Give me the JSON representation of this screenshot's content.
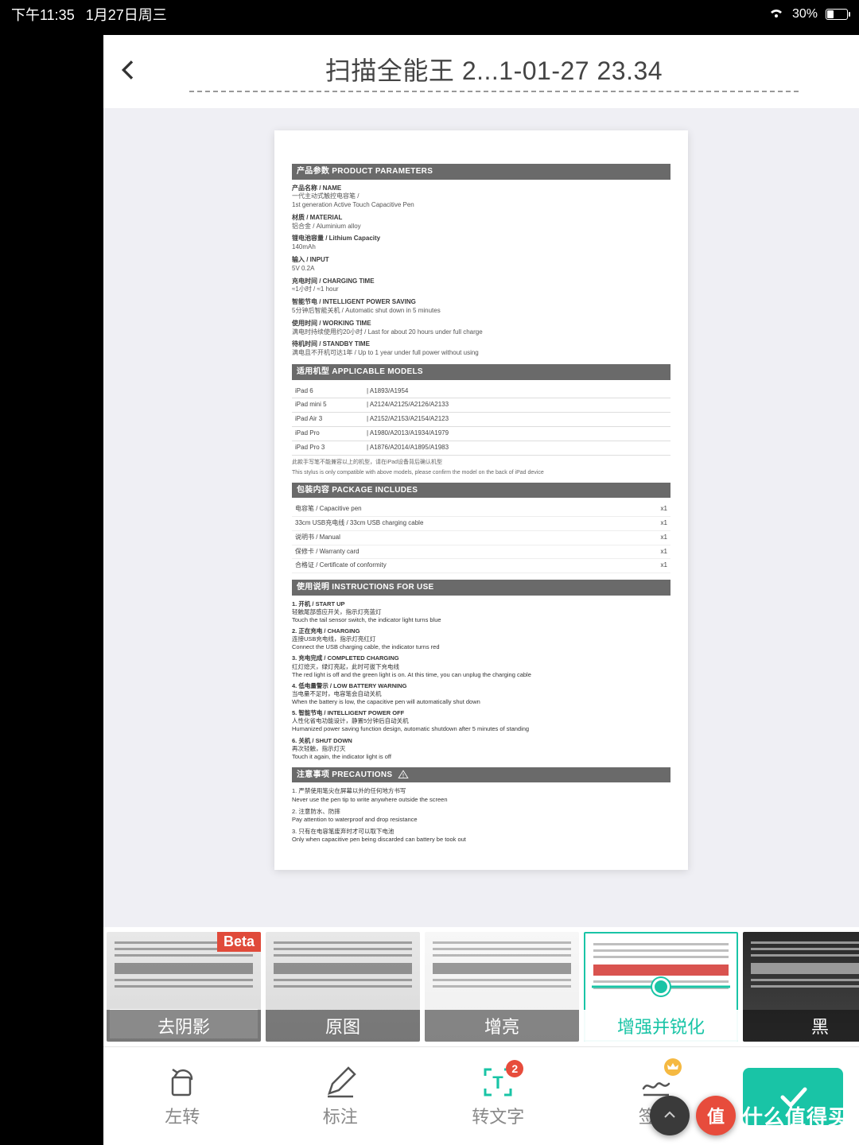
{
  "status": {
    "time": "下午11:35",
    "date": "1月27日周三",
    "battery": "30%"
  },
  "header": {
    "title": "扫描全能王 2...1-01-27 23.34"
  },
  "doc": {
    "sections": {
      "params": {
        "title": "产品参数 PRODUCT PARAMETERS",
        "items": [
          {
            "lbl": "产品名称 / NAME",
            "sub": "一代主动式触控电容笔 /",
            "sub2": "1st generation Active Touch Capacitive Pen"
          },
          {
            "lbl": "材质 / MATERIAL",
            "sub": "铝合金 / Aluminium alloy"
          },
          {
            "lbl": "锂电池容量 / Lithium Capacity",
            "sub": "140mAh"
          },
          {
            "lbl": "输入 / INPUT",
            "sub": "5V 0.2A"
          },
          {
            "lbl": "充电时间 / CHARGING TIME",
            "sub": "≈1小时 / ≈1 hour"
          },
          {
            "lbl": "智能节电 / INTELLIGENT POWER SAVING",
            "sub": "5分钟后智能关机 / Automatic shut down in 5 minutes"
          },
          {
            "lbl": "使用时间 / WORKING TIME",
            "sub": "满电时持续使用约20小时 / Last for about 20 hours under full charge"
          },
          {
            "lbl": "待机时间 / STANDBY TIME",
            "sub": "满电且不开机可达1年 / Up to 1 year under full power without using"
          }
        ]
      },
      "models": {
        "title": "适用机型 APPLICABLE MODELS",
        "rows": [
          {
            "k": "iPad 6",
            "v": "| A1893/A1954"
          },
          {
            "k": "iPad mini 5",
            "v": "| A2124/A2125/A2126/A2133"
          },
          {
            "k": "iPad Air 3",
            "v": "| A2152/A2153/A2154/A2123"
          },
          {
            "k": "iPad Pro",
            "v": "| A1980/A2013/A1934/A1979"
          },
          {
            "k": "iPad Pro 3",
            "v": "| A1876/A2014/A1895/A1983"
          }
        ],
        "note_cn": "此款手写笔不能兼容以上的机型，请在iPad设备背后确认机型",
        "note_en": "This stylus is only compatible with above models, please confirm the model on the back of iPad device"
      },
      "package": {
        "title": "包装内容 PACKAGE INCLUDES",
        "rows": [
          {
            "k": "电容笔 / Capacitive pen",
            "v": "x1"
          },
          {
            "k": "33cm USB充电线 / 33cm USB charging cable",
            "v": "x1"
          },
          {
            "k": "说明书 / Manual",
            "v": "x1"
          },
          {
            "k": "保修卡 / Warranty card",
            "v": "x1"
          },
          {
            "k": "合格证 / Certificate of conformity",
            "v": "x1"
          }
        ]
      },
      "instructions": {
        "title": "使用说明 INSTRUCTIONS FOR USE",
        "items": [
          {
            "t": "1. 开机 / START UP",
            "cn": "轻触尾部感应开关，指示灯亮蓝灯",
            "en": "Touch the tail sensor switch, the indicator light turns blue"
          },
          {
            "t": "2. 正在充电 / CHARGING",
            "cn": "连接USB充电线，指示灯亮红灯",
            "en": "Connect the USB charging cable, the indicator turns red"
          },
          {
            "t": "3. 充电完成 / COMPLETED CHARGING",
            "cn": "红灯熄灭，绿灯亮起，此时可拔下充电线",
            "en": "The red light is off and the green light is on. At this time, you can unplug the charging cable"
          },
          {
            "t": "4. 低电量警示 / LOW BATTERY WARNING",
            "cn": "当电量不足时，电容笔会自动关机",
            "en": "When the battery is low, the capacitive pen will automatically shut down"
          },
          {
            "t": "5. 智能节电 / INTELLIGENT POWER OFF",
            "cn": "人性化省电功能设计，静置5分钟后自动关机",
            "en": "Humanized power saving function design, automatic shutdown after 5 minutes of standing"
          },
          {
            "t": "6. 关机 / SHUT DOWN",
            "cn": "再次轻触，指示灯灭",
            "en": "Touch it again, the indicator light is off"
          }
        ]
      },
      "precautions": {
        "title": "注意事项 PRECAUTIONS",
        "items": [
          {
            "cn": "1. 严禁使用笔尖在屏幕以外的任何地方书写",
            "en": "Never use the pen tip to write anywhere outside the screen"
          },
          {
            "cn": "2. 注意防水、防摔",
            "en": "Pay attention to waterproof and drop resistance"
          },
          {
            "cn": "3. 只有在电容笔废弃时才可以取下电池",
            "en": "Only when capacitive pen being discarded can battery be took out"
          }
        ]
      }
    }
  },
  "filters": [
    {
      "id": "deshadow",
      "label": "去阴影",
      "beta": "Beta"
    },
    {
      "id": "original",
      "label": "原图"
    },
    {
      "id": "brighten",
      "label": "增亮"
    },
    {
      "id": "sharpen",
      "label": "增强并锐化",
      "active": true
    },
    {
      "id": "bw",
      "label": "黑"
    }
  ],
  "toolbar": {
    "rotate": "左转",
    "annotate": "标注",
    "ocr": "转文字",
    "ocr_badge": "2",
    "sign": "签名"
  },
  "watermark": {
    "logo": "值",
    "text": "什么值得买"
  }
}
